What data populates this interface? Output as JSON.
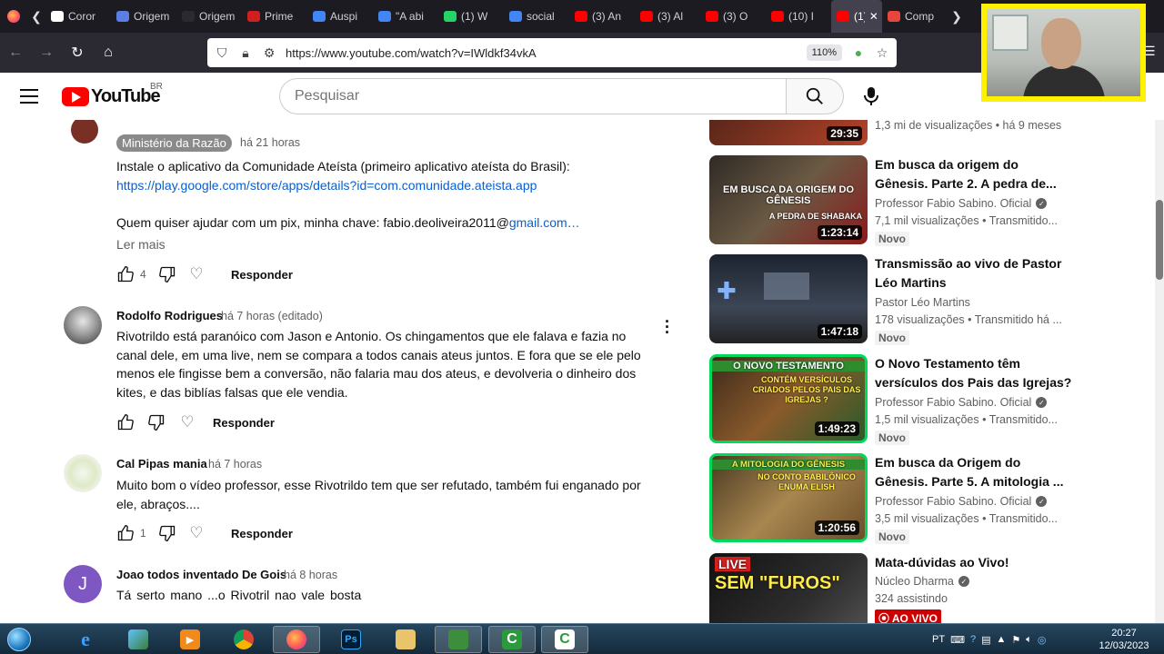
{
  "browser": {
    "tabs": [
      {
        "label": "Coror",
        "color": "#ffffff"
      },
      {
        "label": "Origem",
        "color": "#5b7ee5"
      },
      {
        "label": "Origem",
        "color": "#2b2a33"
      },
      {
        "label": "Prime",
        "color": "#d11f1f"
      },
      {
        "label": "Auspi",
        "color": "#4285f4"
      },
      {
        "label": "\"A abi",
        "color": "#4285f4"
      },
      {
        "label": "(1) W",
        "color": "#25d366"
      },
      {
        "label": "social",
        "color": "#4285f4"
      },
      {
        "label": "(3) An",
        "color": "#ff0000"
      },
      {
        "label": "(3) Al",
        "color": "#ff0000"
      },
      {
        "label": "(3) O",
        "color": "#ff0000"
      },
      {
        "label": "(10) I",
        "color": "#ff0000"
      },
      {
        "label": "(1)",
        "color": "#ff0000"
      },
      {
        "label": "Comp",
        "color": "#e8453c"
      }
    ],
    "url": "https://www.youtube.com/watch?v=IWldkf34vkA",
    "zoom": "110%"
  },
  "youtube": {
    "logo_text": "YouTube",
    "country": "BR",
    "search_placeholder": "Pesquisar"
  },
  "comments": [
    {
      "author": "Ministério da Razão",
      "time": "há 21 horas",
      "text_line1": "Instale o aplicativo da Comunidade Ateísta (primeiro aplicativo ateísta do Brasil):",
      "link": "https://play.google.com/store/apps/details?id=com.comunidade.ateista.app",
      "text_line3": "Quem quiser ajudar com um pix, minha chave: fabio.deoliveira2011@",
      "text_line3_link": "gmail.com…",
      "more": "Ler mais",
      "likes": "4",
      "reply": "Responder"
    },
    {
      "author": "Rodolfo Rodrigues",
      "time": "há 7 horas (editado)",
      "text": "Rivotrildo está paranóico com Jason e Antonio. Os chingamentos que ele falava e fazia no canal dele, em uma live, nem se compara a todos canais ateus juntos. E fora que se ele pelo menos ele fingisse bem a conversão, não falaria mau dos ateus, e devolveria o dinheiro dos kites, e das biblías falsas que ele vendia.",
      "likes": "",
      "reply": "Responder"
    },
    {
      "author": "Cal Pipas mania",
      "time": "há 7 horas",
      "text": "Muito bom o vídeo professor, esse Rivotrildo tem que ser  refutado, também fui enganado por ele, abraços....",
      "likes": "1",
      "reply": "Responder"
    },
    {
      "author": "Joao todos inventado De Gois",
      "time": "há 8 horas",
      "avatar_letter": "J",
      "text": "Tá  serto  mano  ...o  Rivotril  nao  vale  bosta"
    }
  ],
  "sidebar": {
    "top_meta": "1,3 mi de visualizações  • há 9 meses",
    "top_duration": "29:35",
    "videos": [
      {
        "title": "Em busca da origem do Gênesis. Parte 2. A pedra de...",
        "channel": "Professor Fabio Sabino. Oficial",
        "meta": "7,1 mil visualizações  • Transmitido...",
        "badge": "Novo",
        "duration": "1:23:14",
        "thumb_text": "EM BUSCA DA ORIGEM DO GÊNESIS",
        "thumb_sub": "A PEDRA DE SHABAKA"
      },
      {
        "title": "Transmissão ao vivo de Pastor Léo Martins",
        "channel": "Pastor Léo Martins",
        "meta": "178 visualizações  • Transmitido há ...",
        "badge": "Novo",
        "duration": "1:47:18",
        "thumb_text": "",
        "thumb_sub": ""
      },
      {
        "title": "O Novo Testamento têm versículos dos Pais das Igrejas?",
        "channel": "Professor Fabio Sabino. Oficial",
        "meta": "1,5 mil visualizações  • Transmitido...",
        "badge": "Novo",
        "duration": "1:49:23",
        "thumb_text": "O NOVO TESTAMENTO",
        "thumb_sub": "CONTÉM VERSÍCULOS CRIADOS PELOS PAIS DAS IGREJAS ?"
      },
      {
        "title": "Em busca da Origem do Gênesis. Parte 5. A mitologia ...",
        "channel": "Professor Fabio Sabino. Oficial",
        "meta": "3,5 mil visualizações  • Transmitido...",
        "badge": "Novo",
        "duration": "1:20:56",
        "thumb_text": "A MITOLOGIA DO GÊNESIS",
        "thumb_sub": "NO CONTO BABILÔNICO ENUMA ELISH"
      },
      {
        "title": "Mata-dúvidas ao Vivo!",
        "channel": "Núcleo Dharma",
        "meta": "324 assistindo",
        "badge": "AO VIVO",
        "duration": "",
        "thumb_text": "LIVE",
        "thumb_sub": "SEM \"FUROS\""
      }
    ]
  },
  "taskbar": {
    "lang": "PT",
    "time": "20:27",
    "date": "12/03/2023",
    "ps_label": "Ps"
  }
}
